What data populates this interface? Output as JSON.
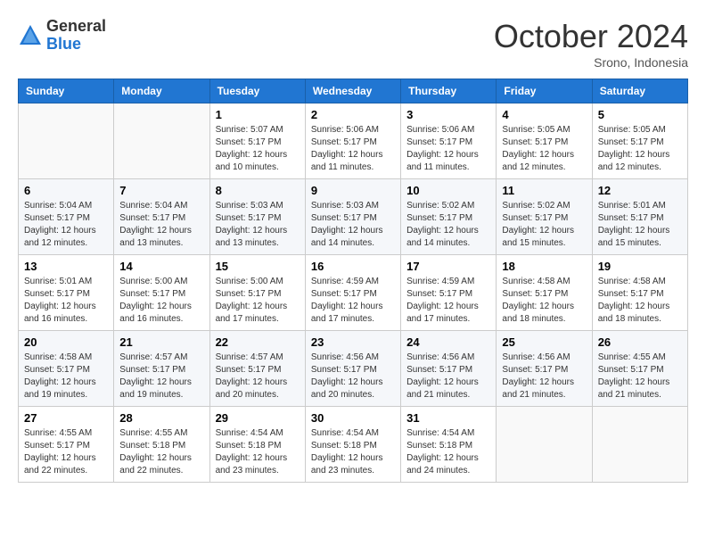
{
  "logo": {
    "general": "General",
    "blue": "Blue"
  },
  "header": {
    "month": "October 2024",
    "location": "Srono, Indonesia"
  },
  "weekdays": [
    "Sunday",
    "Monday",
    "Tuesday",
    "Wednesday",
    "Thursday",
    "Friday",
    "Saturday"
  ],
  "weeks": [
    [
      {
        "day": "",
        "sunrise": "",
        "sunset": "",
        "daylight": ""
      },
      {
        "day": "",
        "sunrise": "",
        "sunset": "",
        "daylight": ""
      },
      {
        "day": "1",
        "sunrise": "Sunrise: 5:07 AM",
        "sunset": "Sunset: 5:17 PM",
        "daylight": "Daylight: 12 hours and 10 minutes."
      },
      {
        "day": "2",
        "sunrise": "Sunrise: 5:06 AM",
        "sunset": "Sunset: 5:17 PM",
        "daylight": "Daylight: 12 hours and 11 minutes."
      },
      {
        "day": "3",
        "sunrise": "Sunrise: 5:06 AM",
        "sunset": "Sunset: 5:17 PM",
        "daylight": "Daylight: 12 hours and 11 minutes."
      },
      {
        "day": "4",
        "sunrise": "Sunrise: 5:05 AM",
        "sunset": "Sunset: 5:17 PM",
        "daylight": "Daylight: 12 hours and 12 minutes."
      },
      {
        "day": "5",
        "sunrise": "Sunrise: 5:05 AM",
        "sunset": "Sunset: 5:17 PM",
        "daylight": "Daylight: 12 hours and 12 minutes."
      }
    ],
    [
      {
        "day": "6",
        "sunrise": "Sunrise: 5:04 AM",
        "sunset": "Sunset: 5:17 PM",
        "daylight": "Daylight: 12 hours and 12 minutes."
      },
      {
        "day": "7",
        "sunrise": "Sunrise: 5:04 AM",
        "sunset": "Sunset: 5:17 PM",
        "daylight": "Daylight: 12 hours and 13 minutes."
      },
      {
        "day": "8",
        "sunrise": "Sunrise: 5:03 AM",
        "sunset": "Sunset: 5:17 PM",
        "daylight": "Daylight: 12 hours and 13 minutes."
      },
      {
        "day": "9",
        "sunrise": "Sunrise: 5:03 AM",
        "sunset": "Sunset: 5:17 PM",
        "daylight": "Daylight: 12 hours and 14 minutes."
      },
      {
        "day": "10",
        "sunrise": "Sunrise: 5:02 AM",
        "sunset": "Sunset: 5:17 PM",
        "daylight": "Daylight: 12 hours and 14 minutes."
      },
      {
        "day": "11",
        "sunrise": "Sunrise: 5:02 AM",
        "sunset": "Sunset: 5:17 PM",
        "daylight": "Daylight: 12 hours and 15 minutes."
      },
      {
        "day": "12",
        "sunrise": "Sunrise: 5:01 AM",
        "sunset": "Sunset: 5:17 PM",
        "daylight": "Daylight: 12 hours and 15 minutes."
      }
    ],
    [
      {
        "day": "13",
        "sunrise": "Sunrise: 5:01 AM",
        "sunset": "Sunset: 5:17 PM",
        "daylight": "Daylight: 12 hours and 16 minutes."
      },
      {
        "day": "14",
        "sunrise": "Sunrise: 5:00 AM",
        "sunset": "Sunset: 5:17 PM",
        "daylight": "Daylight: 12 hours and 16 minutes."
      },
      {
        "day": "15",
        "sunrise": "Sunrise: 5:00 AM",
        "sunset": "Sunset: 5:17 PM",
        "daylight": "Daylight: 12 hours and 17 minutes."
      },
      {
        "day": "16",
        "sunrise": "Sunrise: 4:59 AM",
        "sunset": "Sunset: 5:17 PM",
        "daylight": "Daylight: 12 hours and 17 minutes."
      },
      {
        "day": "17",
        "sunrise": "Sunrise: 4:59 AM",
        "sunset": "Sunset: 5:17 PM",
        "daylight": "Daylight: 12 hours and 17 minutes."
      },
      {
        "day": "18",
        "sunrise": "Sunrise: 4:58 AM",
        "sunset": "Sunset: 5:17 PM",
        "daylight": "Daylight: 12 hours and 18 minutes."
      },
      {
        "day": "19",
        "sunrise": "Sunrise: 4:58 AM",
        "sunset": "Sunset: 5:17 PM",
        "daylight": "Daylight: 12 hours and 18 minutes."
      }
    ],
    [
      {
        "day": "20",
        "sunrise": "Sunrise: 4:58 AM",
        "sunset": "Sunset: 5:17 PM",
        "daylight": "Daylight: 12 hours and 19 minutes."
      },
      {
        "day": "21",
        "sunrise": "Sunrise: 4:57 AM",
        "sunset": "Sunset: 5:17 PM",
        "daylight": "Daylight: 12 hours and 19 minutes."
      },
      {
        "day": "22",
        "sunrise": "Sunrise: 4:57 AM",
        "sunset": "Sunset: 5:17 PM",
        "daylight": "Daylight: 12 hours and 20 minutes."
      },
      {
        "day": "23",
        "sunrise": "Sunrise: 4:56 AM",
        "sunset": "Sunset: 5:17 PM",
        "daylight": "Daylight: 12 hours and 20 minutes."
      },
      {
        "day": "24",
        "sunrise": "Sunrise: 4:56 AM",
        "sunset": "Sunset: 5:17 PM",
        "daylight": "Daylight: 12 hours and 21 minutes."
      },
      {
        "day": "25",
        "sunrise": "Sunrise: 4:56 AM",
        "sunset": "Sunset: 5:17 PM",
        "daylight": "Daylight: 12 hours and 21 minutes."
      },
      {
        "day": "26",
        "sunrise": "Sunrise: 4:55 AM",
        "sunset": "Sunset: 5:17 PM",
        "daylight": "Daylight: 12 hours and 21 minutes."
      }
    ],
    [
      {
        "day": "27",
        "sunrise": "Sunrise: 4:55 AM",
        "sunset": "Sunset: 5:17 PM",
        "daylight": "Daylight: 12 hours and 22 minutes."
      },
      {
        "day": "28",
        "sunrise": "Sunrise: 4:55 AM",
        "sunset": "Sunset: 5:18 PM",
        "daylight": "Daylight: 12 hours and 22 minutes."
      },
      {
        "day": "29",
        "sunrise": "Sunrise: 4:54 AM",
        "sunset": "Sunset: 5:18 PM",
        "daylight": "Daylight: 12 hours and 23 minutes."
      },
      {
        "day": "30",
        "sunrise": "Sunrise: 4:54 AM",
        "sunset": "Sunset: 5:18 PM",
        "daylight": "Daylight: 12 hours and 23 minutes."
      },
      {
        "day": "31",
        "sunrise": "Sunrise: 4:54 AM",
        "sunset": "Sunset: 5:18 PM",
        "daylight": "Daylight: 12 hours and 24 minutes."
      },
      {
        "day": "",
        "sunrise": "",
        "sunset": "",
        "daylight": ""
      },
      {
        "day": "",
        "sunrise": "",
        "sunset": "",
        "daylight": ""
      }
    ]
  ]
}
